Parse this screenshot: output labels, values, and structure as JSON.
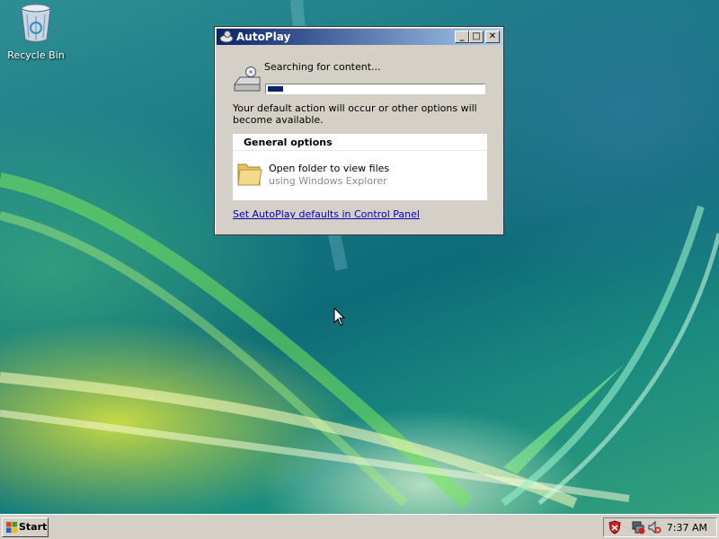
{
  "desktop": {
    "icons": [
      {
        "label": "Recycle Bin",
        "icon": "recycle-bin-icon"
      }
    ]
  },
  "autoplay": {
    "title": "AutoPlay",
    "status_text": "Searching for content...",
    "progress": 0.07,
    "description": "Your default action will occur or other options will become available.",
    "options_header": "General options",
    "option_primary": "Open folder to view files",
    "option_secondary": "using Windows Explorer",
    "link_text": "Set AutoPlay defaults in Control Panel",
    "buttons": {
      "minimize": "_",
      "maximize": "□",
      "close": "✕"
    }
  },
  "taskbar": {
    "start_label": "Start",
    "clock": "7:37 AM",
    "tray_icons": [
      "security-shield-icon",
      "network-disconnected-icon",
      "volume-muted-icon"
    ]
  },
  "colors": {
    "titlebar_start": "#0a246a",
    "titlebar_end": "#a6caf0",
    "link": "#0000c0",
    "chrome": "#d4d0c8"
  }
}
